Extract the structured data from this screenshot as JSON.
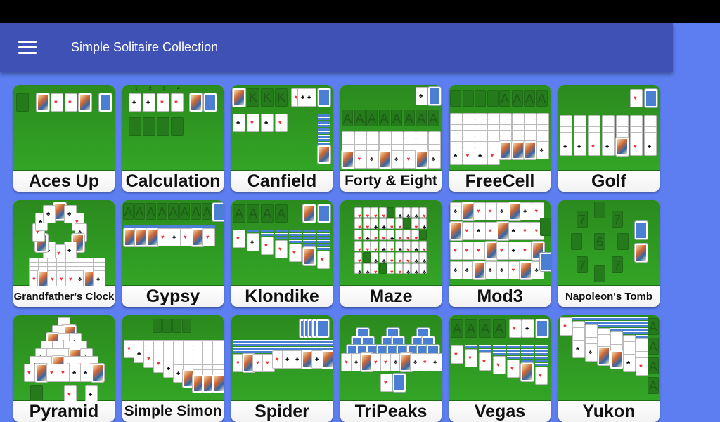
{
  "app": {
    "title": "Simple Solitaire Collection",
    "menu_icon": "hamburger-menu-icon"
  },
  "colors": {
    "app_bar": "#3f51b5",
    "background": "#5c7ef0",
    "board_green": "#33a526",
    "card_back": "#4a7fd4"
  },
  "games": [
    {
      "id": "aces-up",
      "label": "Aces Up"
    },
    {
      "id": "calculation",
      "label": "Calculation"
    },
    {
      "id": "canfield",
      "label": "Canfield"
    },
    {
      "id": "forty-and-eight",
      "label": "Forty & Eight"
    },
    {
      "id": "freecell",
      "label": "FreeCell"
    },
    {
      "id": "golf",
      "label": "Golf"
    },
    {
      "id": "grandfathers-clock",
      "label": "Grandfather's Clock"
    },
    {
      "id": "gypsy",
      "label": "Gypsy"
    },
    {
      "id": "klondike",
      "label": "Klondike"
    },
    {
      "id": "maze",
      "label": "Maze"
    },
    {
      "id": "mod3",
      "label": "Mod3"
    },
    {
      "id": "napoleons-tomb",
      "label": "Napoleon's Tomb"
    },
    {
      "id": "pyramid",
      "label": "Pyramid"
    },
    {
      "id": "simple-simon",
      "label": "Simple Simon"
    },
    {
      "id": "spider",
      "label": "Spider"
    },
    {
      "id": "tripeaks",
      "label": "TriPeaks"
    },
    {
      "id": "vegas",
      "label": "Vegas"
    },
    {
      "id": "yukon",
      "label": "Yukon"
    }
  ],
  "board_text": {
    "calculation_headers": [
      "+1",
      "+2",
      "+3",
      "+4"
    ],
    "foundation_ace": "A",
    "foundation_king": "K",
    "napoleon_seven": "7",
    "napoleon_six": "6"
  }
}
